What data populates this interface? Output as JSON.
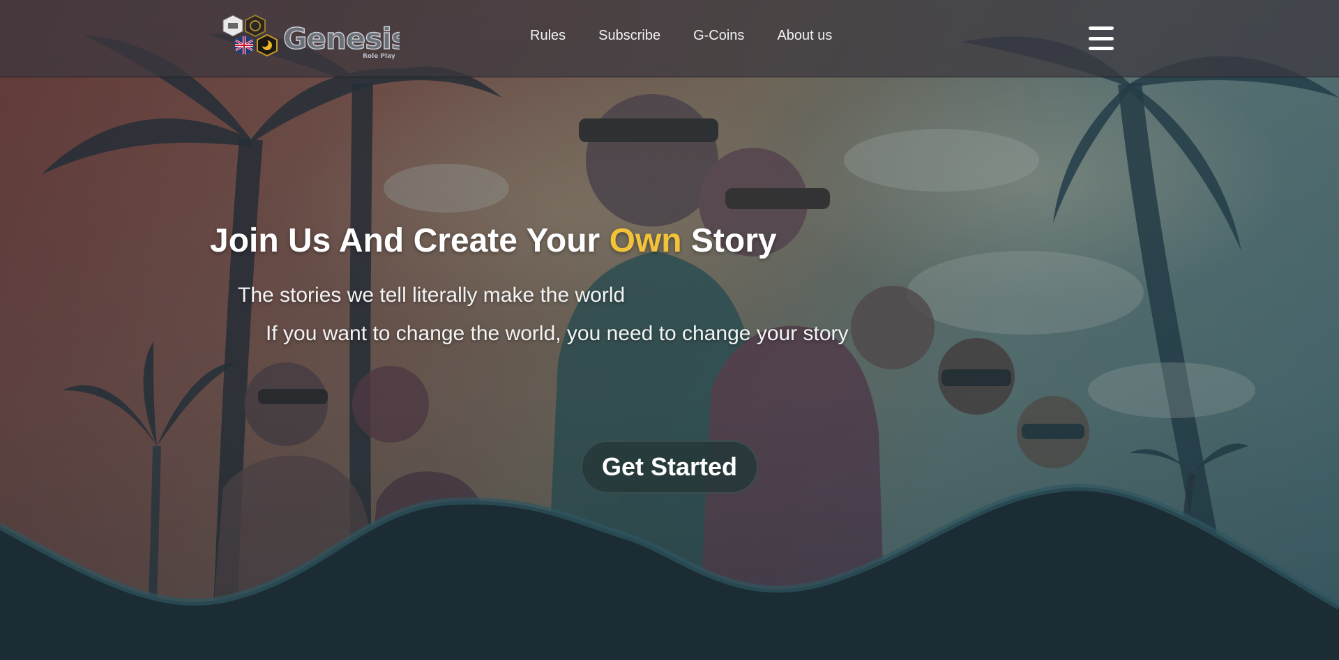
{
  "brand": {
    "logo_text": "Genesis",
    "logo_subtext": "Role Play",
    "accent_color": "#f2c33a"
  },
  "nav": {
    "links": [
      {
        "label": "Rules"
      },
      {
        "label": "Subscribe"
      },
      {
        "label": "G-Coins"
      },
      {
        "label": "About us"
      }
    ],
    "menu_icon": "hamburger-menu-icon",
    "logo_badges": [
      "server-badge-icon",
      "gear-badge-icon",
      "uk-flag-icon",
      "theme-toggle-icon"
    ]
  },
  "hero": {
    "title_before": "Join Us And Create Your ",
    "title_accent": "Own",
    "title_after": " Story",
    "line1": "The stories we tell literally make the world",
    "line2": "If you want to change the world, you need to change your story",
    "cta_label": "Get Started"
  }
}
